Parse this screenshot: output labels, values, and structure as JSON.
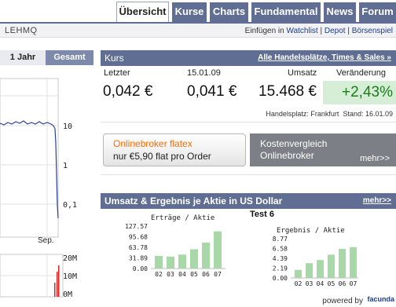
{
  "tabs": [
    {
      "label": "Übersicht",
      "active": true
    },
    {
      "label": "Kurse",
      "active": false
    },
    {
      "label": "Charts",
      "active": false
    },
    {
      "label": "Fundamental",
      "active": false
    },
    {
      "label": "News",
      "active": false
    },
    {
      "label": "Forum",
      "active": false
    }
  ],
  "header": {
    "ticker": "LEHMQ",
    "links": {
      "prefix": "Einfügen in",
      "watchlist": "Watchlist",
      "depot": "Depot",
      "boersenspiel": "Börsenspiel",
      "sep": "|"
    }
  },
  "left_chart": {
    "range_active": "1 Jahr",
    "range_other": "Gesamt",
    "y_ticks": [
      "10",
      "1",
      "0,1"
    ],
    "x_label": "Sep.",
    "vol_ticks": [
      "20M",
      "10M",
      "0M"
    ]
  },
  "kurs": {
    "title": "Kurs",
    "link": "Alle Handelsplätze, Times & Sales »",
    "col_last": "Letzter",
    "col_date": "15.01.09",
    "col_volume": "Umsatz",
    "col_change": "Veränderung",
    "last": "0,042 €",
    "prev": "0,041 €",
    "volume": "15.468 €",
    "change": "+2,43%",
    "place_label": "Handelsplatz: Frankfurt",
    "date_label": "Stand: 16.01.09"
  },
  "ads": {
    "flatex_title": "Onlinebroker flatex",
    "flatex_sub": "nur  €5,90 flat pro Order",
    "kosten_line1": "Kostenvergleich",
    "kosten_line2": "Onlinebroker",
    "kosten_more": "mehr>>"
  },
  "umsatz": {
    "title": "Umsatz & Ergebnis je Aktie in US Dollar",
    "more": "mehr>>",
    "test_label": "Test 6",
    "powered": "powered by",
    "brand": "facunda"
  },
  "colors": {
    "tab_bg": "#5f6e92",
    "bar_green": "#a8d8a8",
    "change_bg": "#d6eed6",
    "change_text": "#1b7a1b",
    "flatex_orange": "#ff6a00"
  },
  "chart_data": [
    {
      "type": "bar",
      "title": "Erträge / Aktie",
      "categories": [
        "02",
        "03",
        "04",
        "05",
        "06",
        "07"
      ],
      "y_ticks": [
        "127.57",
        "95.68",
        "63.78",
        "31.89",
        "0.00"
      ],
      "ylim": [
        0,
        127.57
      ],
      "values": [
        38,
        36,
        42,
        58,
        78,
        112
      ]
    },
    {
      "type": "bar",
      "title": "Ergebnis / Aktie",
      "categories": [
        "02",
        "03",
        "04",
        "05",
        "06",
        "07"
      ],
      "y_ticks": [
        "8.77",
        "6.58",
        "4.39",
        "2.19",
        "0.00"
      ],
      "ylim": [
        0,
        8.77
      ],
      "values": [
        1.8,
        3.3,
        4.0,
        5.2,
        6.5,
        6.9
      ]
    }
  ]
}
